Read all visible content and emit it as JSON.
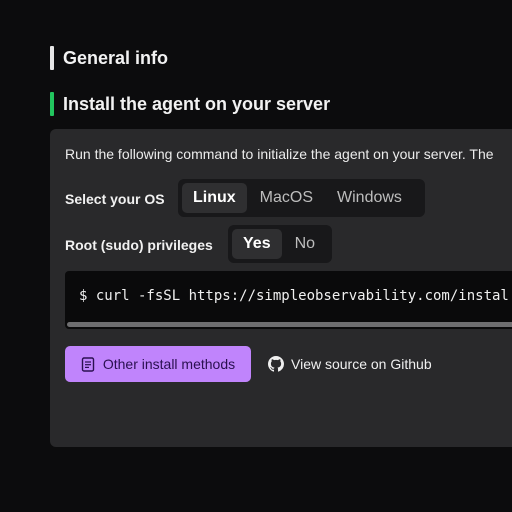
{
  "colors": {
    "background": "#0c0c0d",
    "card": "#29292b",
    "general_bar": "#e6e6e6",
    "install_bar": "#22c55e",
    "primary_button": "#c084fc"
  },
  "sections": {
    "general_info": "General info",
    "install_agent": "Install the agent on your server"
  },
  "card": {
    "intro": "Run the following command to initialize the agent on your server. The",
    "os_label": "Select your OS",
    "os_options": [
      "Linux",
      "MacOS",
      "Windows"
    ],
    "os_selected": "Linux",
    "root_label": "Root (sudo) privileges",
    "root_options": [
      "Yes",
      "No"
    ],
    "root_selected": "Yes",
    "command": "$ curl -fsSL https://simpleobservability.com/instal"
  },
  "actions": {
    "other_methods": "Other install methods",
    "other_methods_icon": "document-icon",
    "github": "View source on Github",
    "github_icon": "github-icon"
  }
}
